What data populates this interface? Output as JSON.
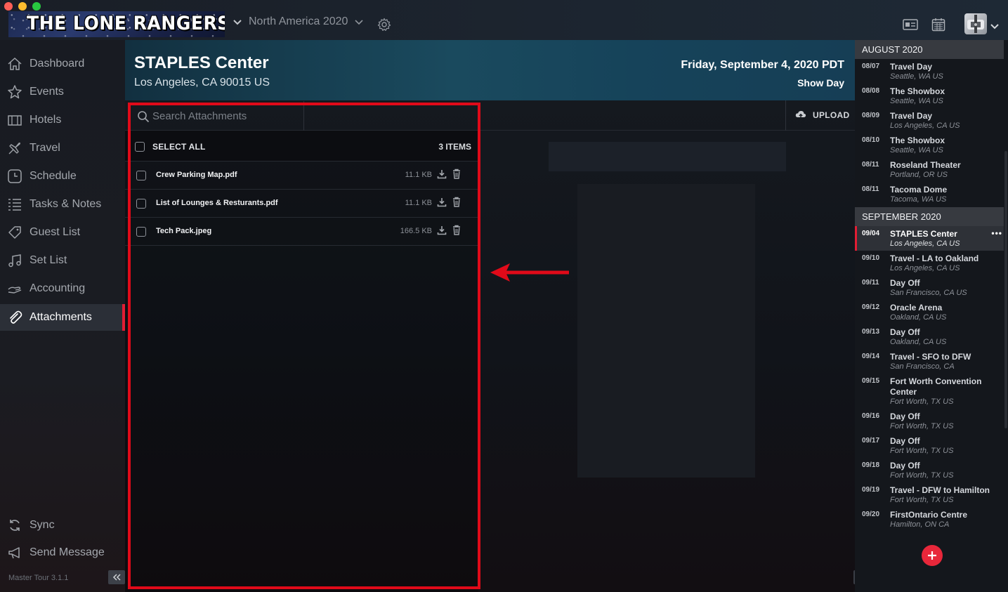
{
  "brand": {
    "title": "THE LONE RANGERS"
  },
  "topbar": {
    "tour_name": "North America 2020"
  },
  "sidebar": {
    "items": [
      {
        "label": "Dashboard",
        "icon": "home-icon"
      },
      {
        "label": "Events",
        "icon": "star-icon"
      },
      {
        "label": "Hotels",
        "icon": "hotel-icon"
      },
      {
        "label": "Travel",
        "icon": "plane-icon"
      },
      {
        "label": "Schedule",
        "icon": "clock-icon"
      },
      {
        "label": "Tasks & Notes",
        "icon": "list-icon"
      },
      {
        "label": "Guest List",
        "icon": "ticket-icon"
      },
      {
        "label": "Set List",
        "icon": "music-note-icon"
      },
      {
        "label": "Accounting",
        "icon": "money-icon"
      },
      {
        "label": "Attachments",
        "icon": "paperclip-icon",
        "active": true
      }
    ],
    "sync": "Sync",
    "send_message": "Send Message",
    "version": "Master Tour 3.1.1"
  },
  "header": {
    "venue": "STAPLES Center",
    "address": "Los Angeles, CA 90015 US",
    "date": "Friday, September 4, 2020 PDT",
    "day_type": "Show Day"
  },
  "attachments": {
    "search_placeholder": "Search Attachments",
    "upload_label": "UPLOAD",
    "select_all": "SELECT ALL",
    "count": "3 ITEMS",
    "files": [
      {
        "name": "Crew Parking Map.pdf",
        "size": "11.1 KB"
      },
      {
        "name": "List of Lounges & Resturants.pdf",
        "size": "11.1 KB"
      },
      {
        "name": "Tech Pack.jpeg",
        "size": "166.5 KB"
      }
    ]
  },
  "schedule": {
    "months": [
      {
        "label": "AUGUST 2020",
        "events": [
          {
            "date": "08/07",
            "title": "Travel Day",
            "location": "Seattle, WA US"
          },
          {
            "date": "08/08",
            "title": "The Showbox",
            "location": "Seattle, WA US"
          },
          {
            "date": "08/09",
            "title": "Travel Day",
            "location": "Los Angeles, CA US"
          },
          {
            "date": "08/10",
            "title": "The Showbox",
            "location": "Seattle, WA US"
          },
          {
            "date": "08/11",
            "title": "Roseland Theater",
            "location": "Portland, OR US"
          },
          {
            "date": "08/11",
            "title": "Tacoma Dome",
            "location": "Tacoma, WA US"
          }
        ]
      },
      {
        "label": "SEPTEMBER 2020",
        "events": [
          {
            "date": "09/04",
            "title": "STAPLES Center",
            "location": "Los Angeles, CA US",
            "selected": true
          },
          {
            "date": "09/10",
            "title": "Travel - LA to Oakland",
            "location": "Los Angeles, CA US"
          },
          {
            "date": "09/11",
            "title": "Day Off",
            "location": "San Francisco, CA US"
          },
          {
            "date": "09/12",
            "title": "Oracle Arena",
            "location": "Oakland, CA US"
          },
          {
            "date": "09/13",
            "title": "Day Off",
            "location": "Oakland, CA US"
          },
          {
            "date": "09/14",
            "title": "Travel - SFO to DFW",
            "location": "San Francisco, CA"
          },
          {
            "date": "09/15",
            "title": "Fort Worth Convention Center",
            "location": "Fort Worth, TX US"
          },
          {
            "date": "09/16",
            "title": "Day Off",
            "location": "Fort Worth, TX US"
          },
          {
            "date": "09/17",
            "title": "Day Off",
            "location": "Fort Worth, TX US"
          },
          {
            "date": "09/18",
            "title": "Day Off",
            "location": "Fort Worth, TX US"
          },
          {
            "date": "09/19",
            "title": "Travel - DFW to Hamilton",
            "location": "Fort Worth, TX US"
          },
          {
            "date": "09/20",
            "title": "FirstOntario Centre",
            "location": "Hamilton, ON CA"
          }
        ]
      }
    ],
    "more_label": "•••"
  },
  "colors": {
    "accent": "#e21d34",
    "highlight": "#e00a19"
  }
}
